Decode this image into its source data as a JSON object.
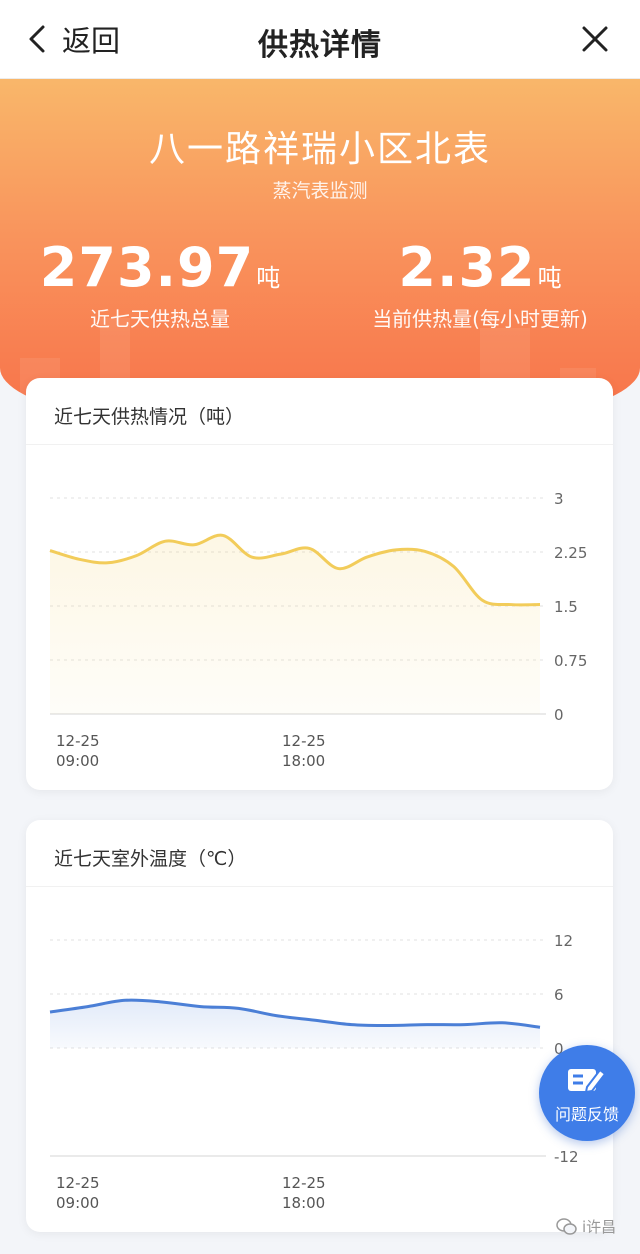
{
  "nav": {
    "back_label": "返回",
    "title": "供热详情"
  },
  "hero": {
    "title": "八一路祥瑞小区北表",
    "subtitle": "蒸汽表监测",
    "total": {
      "value": "273.97",
      "unit": "吨",
      "label": "近七天供热总量"
    },
    "current": {
      "value": "2.32",
      "unit": "吨",
      "label": "当前供热量(每小时更新)"
    }
  },
  "chart_data": [
    {
      "type": "area",
      "title": "近七天供热情况（吨）",
      "xlabel": "",
      "ylabel": "",
      "ylim": [
        0,
        3
      ],
      "yticks": [
        "3",
        "2.25",
        "1.5",
        "0.75",
        "0"
      ],
      "xticks": [
        {
          "date": "12-25",
          "time": "09:00"
        },
        {
          "date": "12-25",
          "time": "18:00"
        }
      ],
      "grid": true,
      "color": "#f2cc5a",
      "series": [
        {
          "values": [
            2.27,
            2.15,
            2.1,
            2.2,
            2.4,
            2.35,
            2.48,
            2.18,
            2.22,
            2.3,
            2.02,
            2.18,
            2.28,
            2.26,
            2.05,
            1.58,
            1.52,
            1.52
          ]
        }
      ]
    },
    {
      "type": "area",
      "title": "近七天室外温度（℃）",
      "xlabel": "",
      "ylabel": "",
      "ylim": [
        -12,
        12
      ],
      "yticks": [
        "12",
        "6",
        "0",
        "-12"
      ],
      "xticks": [
        {
          "date": "12-25",
          "time": "09:00"
        },
        {
          "date": "12-25",
          "time": "18:00"
        }
      ],
      "grid": true,
      "color": "#4b7fd6",
      "series": [
        {
          "values": [
            4.0,
            4.6,
            5.3,
            5.1,
            4.6,
            4.4,
            3.6,
            3.1,
            2.6,
            2.5,
            2.6,
            2.6,
            2.8,
            2.3
          ]
        }
      ]
    }
  ],
  "feedback": {
    "label": "问题反馈"
  },
  "watermark": {
    "text": "i许昌"
  }
}
